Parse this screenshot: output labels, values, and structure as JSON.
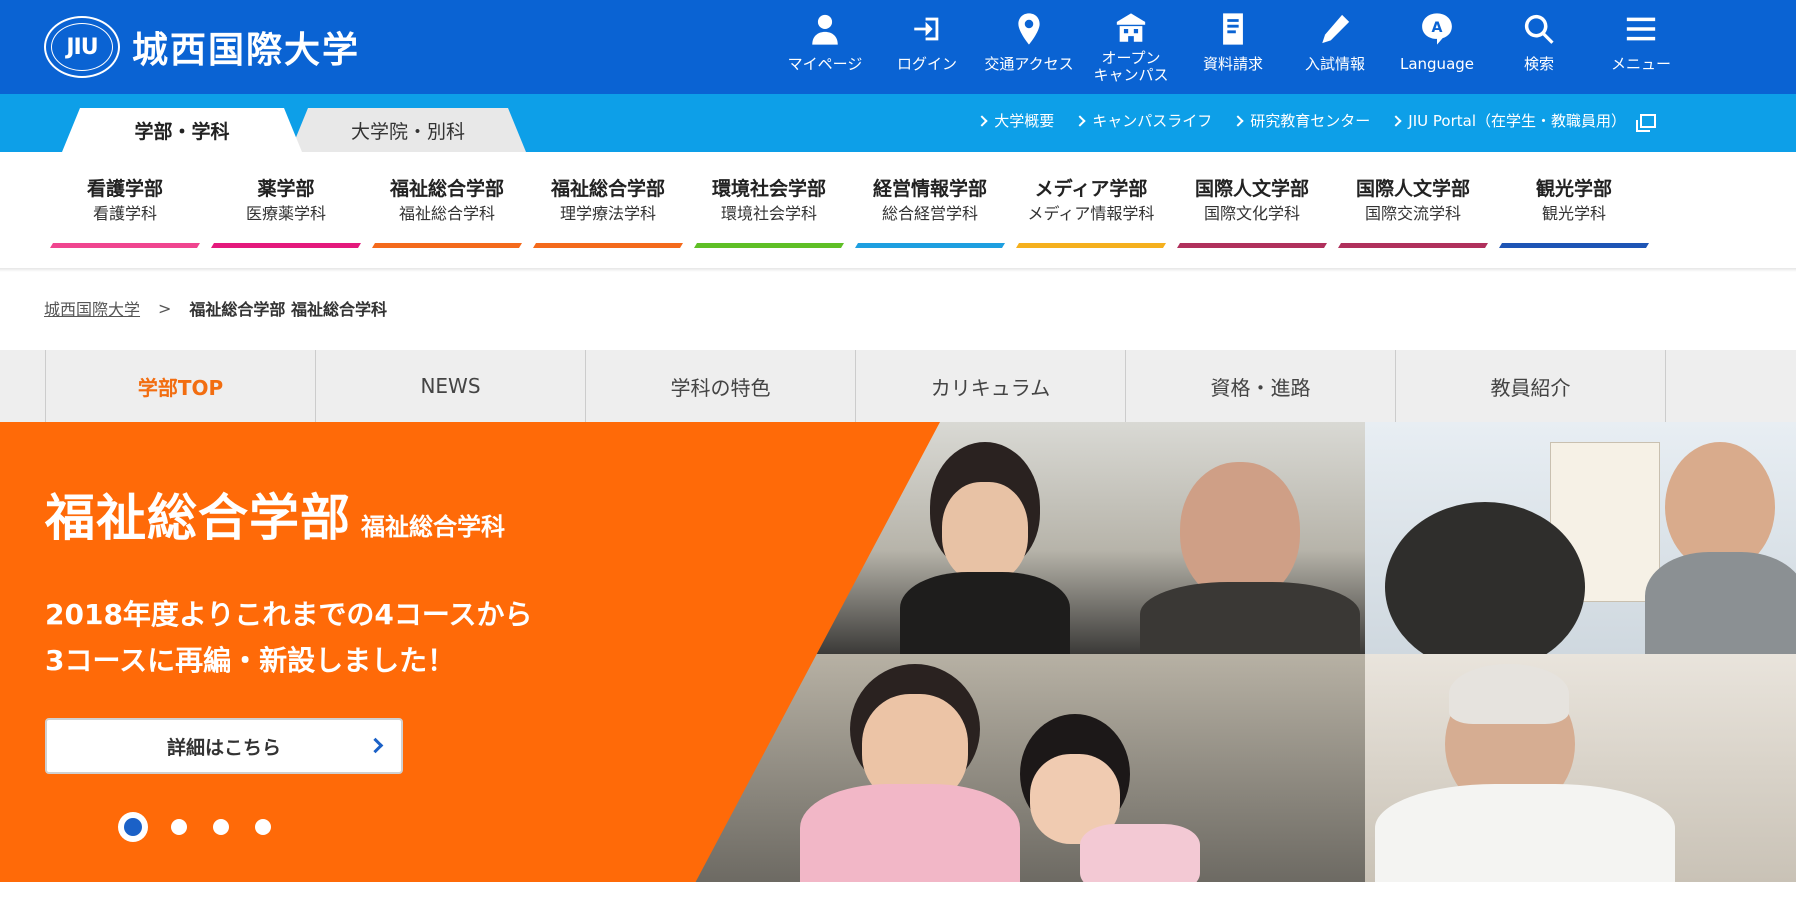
{
  "brand": {
    "seal_text": "JIU",
    "name": "城西国際大学",
    "accent": "#0a63d3",
    "subbar_color": "#0d9fe8",
    "hero_color": "#ff6a08"
  },
  "top_nav": [
    {
      "label": "マイページ",
      "icon": "user-icon"
    },
    {
      "label": "ログイン",
      "icon": "login-icon"
    },
    {
      "label": "交通アクセス",
      "icon": "map-pin-icon"
    },
    {
      "label": "オープン\nキャンパス",
      "icon": "campus-building-icon"
    },
    {
      "label": "資料請求",
      "icon": "brochure-icon"
    },
    {
      "label": "入試情報",
      "icon": "pencil-icon"
    },
    {
      "label": "Language",
      "icon": "language-bubble-icon"
    },
    {
      "label": "検索",
      "icon": "search-icon"
    },
    {
      "label": "メニュー",
      "icon": "hamburger-menu-icon"
    }
  ],
  "tabs": {
    "active": "学部・学科",
    "inactive": "大学院・別科"
  },
  "sublinks": [
    {
      "label": "大学概要"
    },
    {
      "label": "キャンパスライフ"
    },
    {
      "label": "研究教育センター"
    },
    {
      "label": "JIU Portal（在学生・教職員用）"
    }
  ],
  "faculties": [
    {
      "dept": "看護学部",
      "major": "看護学科",
      "color": "#f0458f"
    },
    {
      "dept": "薬学部",
      "major": "医療薬学科",
      "color": "#e4197c"
    },
    {
      "dept": "福祉総合学部",
      "major": "福祉総合学科",
      "color": "#f46a1c"
    },
    {
      "dept": "福祉総合学部",
      "major": "理学療法学科",
      "color": "#f46a1c"
    },
    {
      "dept": "環境社会学部",
      "major": "環境社会学科",
      "color": "#5fbf26"
    },
    {
      "dept": "経営情報学部",
      "major": "総合経営学科",
      "color": "#1e9fe0"
    },
    {
      "dept": "メディア学部",
      "major": "メディア情報学科",
      "color": "#f5b01e"
    },
    {
      "dept": "国際人文学部",
      "major": "国際文化学科",
      "color": "#b0305c"
    },
    {
      "dept": "国際人文学部",
      "major": "国際交流学科",
      "color": "#b0305c"
    },
    {
      "dept": "観光学部",
      "major": "観光学科",
      "color": "#1e55b5"
    }
  ],
  "breadcrumb": {
    "home": "城西国際大学",
    "separator": ">",
    "current": "福祉総合学部 福祉総合学科"
  },
  "local_nav": [
    {
      "label": "学部TOP",
      "active": true
    },
    {
      "label": "NEWS",
      "active": false
    },
    {
      "label": "学科の特色",
      "active": false
    },
    {
      "label": "カリキュラム",
      "active": false
    },
    {
      "label": "資格・進路",
      "active": false
    },
    {
      "label": "教員紹介",
      "active": false
    }
  ],
  "hero": {
    "title": "福祉総合学部",
    "subtitle": "福祉総合学科",
    "line1": "2018年度よりこれまでの4コースから",
    "line2": "3コースに再編・新設しました！",
    "button": "詳細はこちら",
    "slides": 4,
    "active_slide": 1
  }
}
